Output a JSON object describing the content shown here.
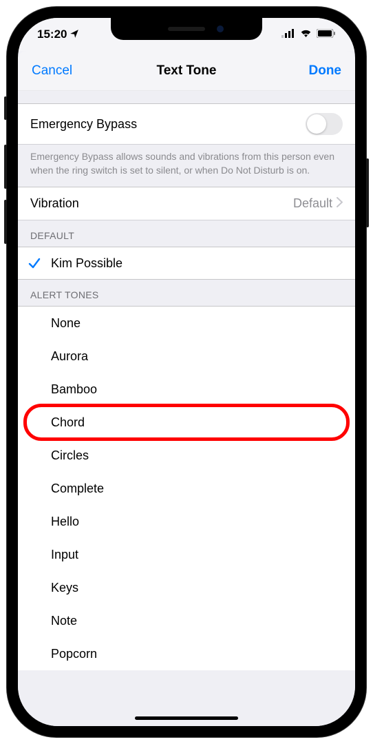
{
  "status": {
    "time": "15:20",
    "location_icon": "➤"
  },
  "nav": {
    "cancel": "Cancel",
    "title": "Text Tone",
    "done": "Done"
  },
  "emergency": {
    "label": "Emergency Bypass",
    "enabled": false,
    "footer": "Emergency Bypass allows sounds and vibrations from this person even when the ring switch is set to silent, or when Do Not Disturb is on."
  },
  "vibration": {
    "label": "Vibration",
    "value": "Default"
  },
  "sections": {
    "default_header": "DEFAULT",
    "default_item": "Kim Possible",
    "alert_header": "ALERT TONES",
    "alert_items": [
      "None",
      "Aurora",
      "Bamboo",
      "Chord",
      "Circles",
      "Complete",
      "Hello",
      "Input",
      "Keys",
      "Note",
      "Popcorn"
    ]
  },
  "highlighted_index": 3
}
